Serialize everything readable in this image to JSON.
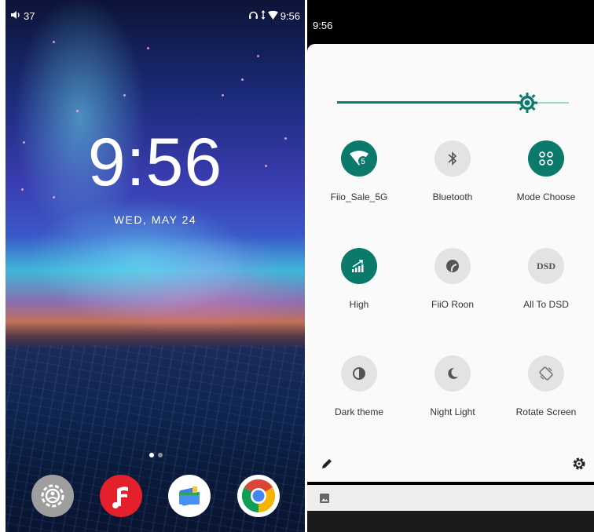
{
  "home": {
    "status_left": {
      "volume_value": "37"
    },
    "status_right": {
      "time": "9:56"
    },
    "clock": "9:56",
    "date": "WED, MAY 24",
    "dock": [
      {
        "name": "settings-app",
        "icon": "gear-badge-icon",
        "color": "#9e9e9e"
      },
      {
        "name": "fiio-music-app",
        "icon": "music-note-icon",
        "color": "#e0202c"
      },
      {
        "name": "files-app",
        "icon": "files-icon",
        "color": "#ffffff"
      },
      {
        "name": "chrome-app",
        "icon": "chrome-icon",
        "color": "#ffffff"
      }
    ]
  },
  "quick_settings": {
    "time": "9:56",
    "brightness": 0.82,
    "accent_color": "#0b7a6b",
    "tiles": [
      {
        "label": "Fiio_Sale_5G",
        "icon": "wifi-icon",
        "active": true
      },
      {
        "label": "Bluetooth",
        "icon": "bluetooth-icon",
        "active": false
      },
      {
        "label": "Mode Choose",
        "icon": "mode-grid-icon",
        "active": true
      },
      {
        "label": "High",
        "icon": "signal-high-icon",
        "active": true
      },
      {
        "label": "FiiO Roon",
        "icon": "roon-icon",
        "active": false
      },
      {
        "label": "All To DSD",
        "icon": "dsd-icon",
        "active": false,
        "text": "DSD"
      },
      {
        "label": "Dark theme",
        "icon": "dark-theme-icon",
        "active": false
      },
      {
        "label": "Night Light",
        "icon": "moon-icon",
        "active": false
      },
      {
        "label": "Rotate Screen",
        "icon": "rotate-icon",
        "active": false
      }
    ]
  }
}
